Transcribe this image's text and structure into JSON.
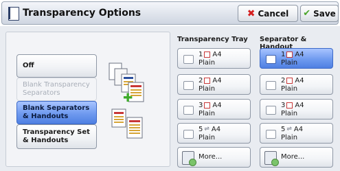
{
  "header": {
    "title": "Transparency Options",
    "cancel_label": "Cancel",
    "save_label": "Save"
  },
  "left_panel": {
    "options": [
      {
        "label": "Off",
        "state": "normal"
      },
      {
        "label": "Blank Transparency Separators",
        "state": "disabled"
      },
      {
        "label": "Blank Separators & Handouts",
        "state": "selected"
      },
      {
        "label": "Transparency Set & Handouts",
        "state": "normal"
      }
    ]
  },
  "transparency_tray": {
    "heading": "Transparency Tray",
    "trays": [
      {
        "number": "1",
        "size": "A4",
        "type": "Plain",
        "selected": false
      },
      {
        "number": "2",
        "size": "A4",
        "type": "Plain",
        "selected": false
      },
      {
        "number": "3",
        "size": "A4",
        "type": "Plain",
        "selected": false
      },
      {
        "number": "5",
        "size": "A4",
        "type": "Plain",
        "selected": false
      }
    ],
    "more_label": "More..."
  },
  "separator_handout": {
    "heading": "Separator & Handout",
    "trays": [
      {
        "number": "1",
        "size": "A4",
        "type": "Plain",
        "selected": true
      },
      {
        "number": "2",
        "size": "A4",
        "type": "Plain",
        "selected": false
      },
      {
        "number": "3",
        "size": "A4",
        "type": "Plain",
        "selected": false
      },
      {
        "number": "5",
        "size": "A4",
        "type": "Plain",
        "selected": false
      }
    ],
    "more_label": "More..."
  },
  "colors": {
    "selected": "#6f9aef",
    "cancel_icon": "#d42020",
    "save_icon": "#4aa52a"
  }
}
